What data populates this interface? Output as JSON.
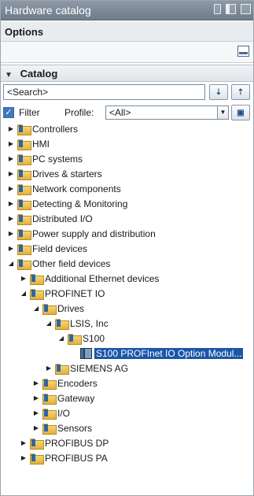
{
  "window": {
    "title": "Hardware catalog"
  },
  "options": {
    "title": "Options"
  },
  "catalog": {
    "title": "Catalog",
    "search": {
      "value": "<Search>"
    },
    "filter": {
      "label": "Filter",
      "checked": true
    },
    "profile": {
      "label": "Profile:",
      "value": "<All>"
    }
  },
  "tree": [
    {
      "label": "Controllers",
      "level": 0,
      "expanded": false,
      "icon": "folder-icon"
    },
    {
      "label": "HMI",
      "level": 0,
      "expanded": false,
      "icon": "folder-icon"
    },
    {
      "label": "PC systems",
      "level": 0,
      "expanded": false,
      "icon": "folder-icon"
    },
    {
      "label": "Drives & starters",
      "level": 0,
      "expanded": false,
      "icon": "folder-icon"
    },
    {
      "label": "Network components",
      "level": 0,
      "expanded": false,
      "icon": "folder-icon"
    },
    {
      "label": "Detecting & Monitoring",
      "level": 0,
      "expanded": false,
      "icon": "folder-icon"
    },
    {
      "label": "Distributed I/O",
      "level": 0,
      "expanded": false,
      "icon": "folder-icon"
    },
    {
      "label": "Power supply and distribution",
      "level": 0,
      "expanded": false,
      "icon": "folder-icon"
    },
    {
      "label": "Field devices",
      "level": 0,
      "expanded": false,
      "icon": "folder-icon"
    },
    {
      "label": "Other field devices",
      "level": 0,
      "expanded": true,
      "icon": "folder-icon"
    },
    {
      "label": "Additional Ethernet devices",
      "level": 1,
      "expanded": false,
      "icon": "folder-icon"
    },
    {
      "label": "PROFINET IO",
      "level": 1,
      "expanded": true,
      "icon": "folder-icon"
    },
    {
      "label": "Drives",
      "level": 2,
      "expanded": true,
      "icon": "folder-icon"
    },
    {
      "label": "LSIS, Inc",
      "level": 3,
      "expanded": true,
      "icon": "folder-icon"
    },
    {
      "label": "S100",
      "level": 4,
      "expanded": true,
      "icon": "folder-icon"
    },
    {
      "label": "S100 PROFInet IO Option Modul...",
      "level": 5,
      "expanded": null,
      "icon": "device-module-icon",
      "selected": true
    },
    {
      "label": "SIEMENS AG",
      "level": 3,
      "expanded": false,
      "icon": "folder-icon"
    },
    {
      "label": "Encoders",
      "level": 2,
      "expanded": false,
      "icon": "folder-icon"
    },
    {
      "label": "Gateway",
      "level": 2,
      "expanded": false,
      "icon": "folder-icon"
    },
    {
      "label": "I/O",
      "level": 2,
      "expanded": false,
      "icon": "folder-icon"
    },
    {
      "label": "Sensors",
      "level": 2,
      "expanded": false,
      "icon": "folder-icon"
    },
    {
      "label": "PROFIBUS DP",
      "level": 1,
      "expanded": false,
      "icon": "folder-icon"
    },
    {
      "label": "PROFIBUS PA",
      "level": 1,
      "expanded": false,
      "icon": "folder-icon"
    }
  ],
  "colors": {
    "titlebar": "#7a8694",
    "selection": "#1b56a8",
    "folder": "#e3b13a"
  }
}
